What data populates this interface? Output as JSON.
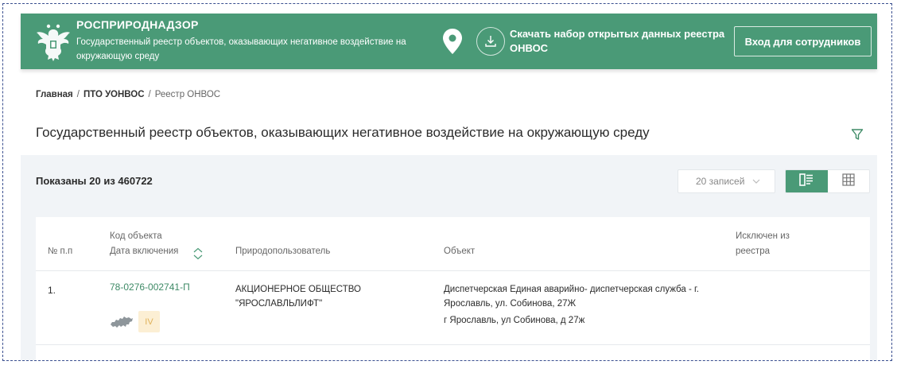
{
  "header": {
    "org_name": "РОСПРИРОДНАДЗОР",
    "org_subtitle": "Государственный реестр объектов, оказывающих негативное воздействие на окружающую среду",
    "download_label": "Скачать набор открытых данных реестра ОНВОС",
    "login_label": "Вход для сотрудников",
    "brand_color": "#4a9a77",
    "icons": [
      "emblem-icon",
      "location-pin-icon",
      "download-icon"
    ]
  },
  "breadcrumb": {
    "items": [
      "Главная",
      "ПТО УОНВОС"
    ],
    "separator": "/",
    "current": "Реестр ОНВОС"
  },
  "page": {
    "title": "Государственный реестр объектов, оказывающих негативное воздействие на окружающую среду"
  },
  "toolbar": {
    "shown_label": "Показаны 20 из 460722",
    "page_size_value": "20 записей",
    "view_modes": [
      "list-view-icon",
      "grid-view-icon"
    ],
    "active_view": "list"
  },
  "table": {
    "headers": {
      "num": "№ п.п",
      "code": "Код объекта",
      "date": "Дата включения",
      "user": "Природопользователь",
      "object": "Объект",
      "excluded": "Исключен из реестра"
    },
    "rows": [
      {
        "num": "1.",
        "code": "78-0276-002741-П",
        "category": "IV",
        "user": "АКЦИОНЕРНОЕ ОБЩЕСТВО \"ЯРОСЛАВЛЬЛИФТ\"",
        "object_name": "Диспетчерская Единая аварийно- диспетчерская служба - г. Ярославль, ул. Собинова, 27Ж",
        "object_address": "г Ярославль, ул Собинова, д 27ж",
        "excluded": ""
      }
    ]
  }
}
